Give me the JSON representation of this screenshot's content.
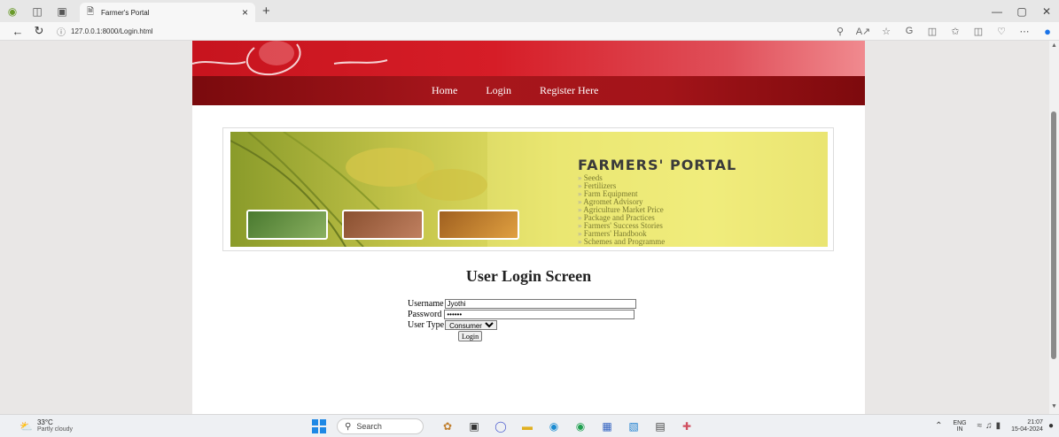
{
  "browser": {
    "tab_title": "Farmer's Portal",
    "tab_close": "×",
    "new_tab": "+",
    "url": "127.0.0.1:8000/Login.html",
    "window_controls": [
      "—",
      "▢",
      "✕"
    ]
  },
  "nav": {
    "links": [
      "Home",
      "Login",
      "Register Here"
    ]
  },
  "hero": {
    "title": "FARMERS' PORTAL",
    "items": [
      "Seeds",
      "Fertilizers",
      "Farm Equipment",
      "Agromet Advisory",
      "Agriculture Market Price",
      "Package and Practices",
      "Farmers' Success Stories",
      "Farmers' Handbook",
      "Schemes and Programme"
    ]
  },
  "login": {
    "title": "User Login Screen",
    "username_label": "Username",
    "username_value": "Jyothi",
    "password_label": "Password",
    "password_value": "Jyothi",
    "usertype_label": "User Type",
    "usertype_selected": "Consumer",
    "button": "Login"
  },
  "taskbar": {
    "temp": "33°C",
    "weather": "Partly cloudy",
    "search": "Search",
    "lang_top": "ENG",
    "lang_bottom": "IN",
    "time": "21:07",
    "date": "15-04-2024"
  },
  "colors": {
    "banner_red": "#c7141e",
    "nav_dark_red": "#8b0f13",
    "hero_yellow": "#e7e36a"
  }
}
